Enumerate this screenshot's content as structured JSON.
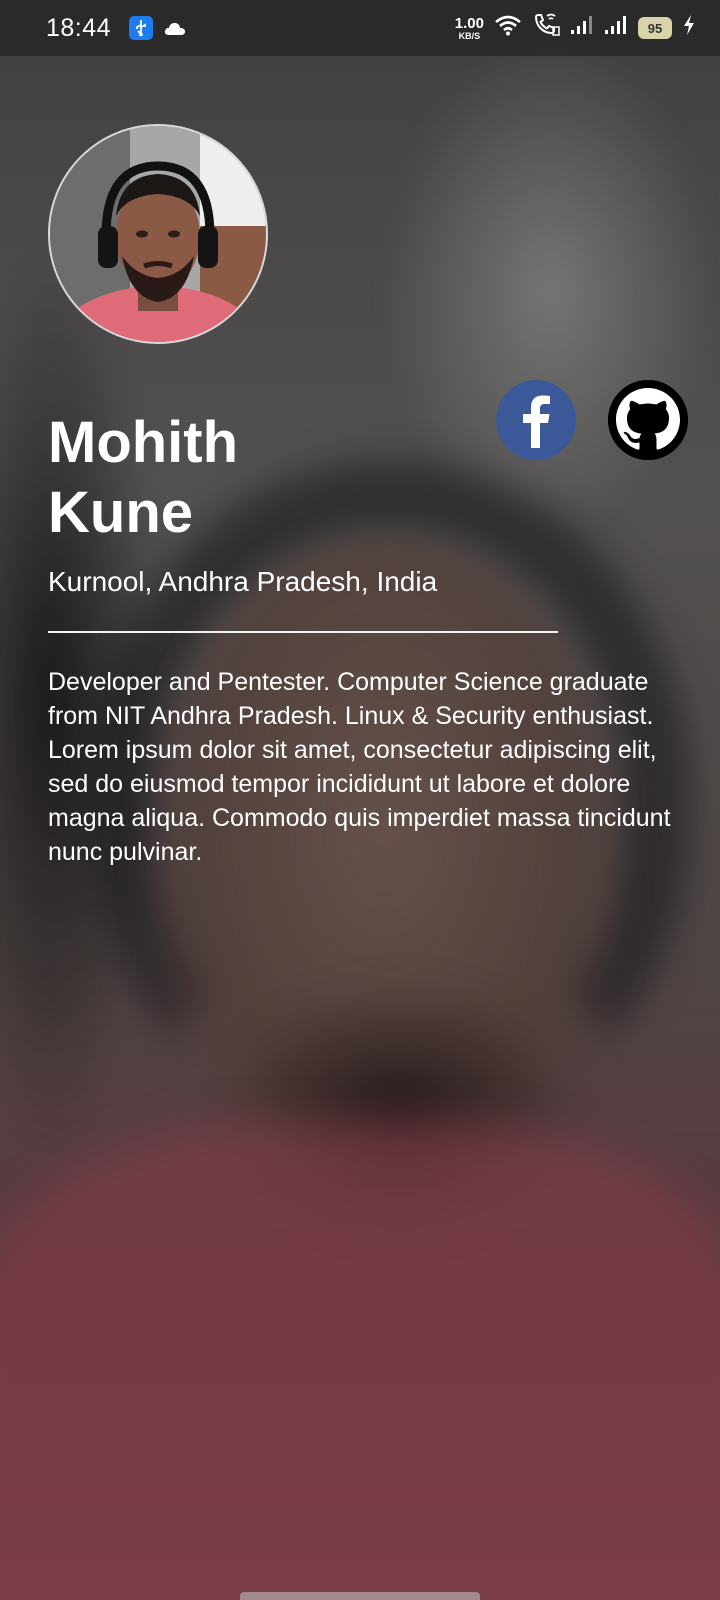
{
  "status_bar": {
    "time": "18:44",
    "net_speed_value": "1.00",
    "net_speed_unit": "KB/S",
    "battery_level": "95",
    "icons": [
      "usb-icon",
      "cloud-icon",
      "wifi-icon",
      "wifi-calling-icon",
      "signal-icon",
      "signal-icon",
      "battery-icon",
      "charging-icon"
    ]
  },
  "profile": {
    "name": "Mohith Kune",
    "location": "Kurnool, Andhra Pradesh, India",
    "bio": "Developer and Pentester. Computer Science graduate from NIT Andhra Pradesh. Linux & Security enthusiast. Lorem ipsum dolor sit amet, consectetur adipiscing elit, sed do eiusmod tempor incididunt ut labore et dolore magna aliqua. Commodo quis imperdiet massa tincidunt nunc pulvinar."
  },
  "social": {
    "facebook_icon": "facebook-icon",
    "github_icon": "github-icon",
    "facebook_color": "#3b5998",
    "github_color": "#000000"
  }
}
